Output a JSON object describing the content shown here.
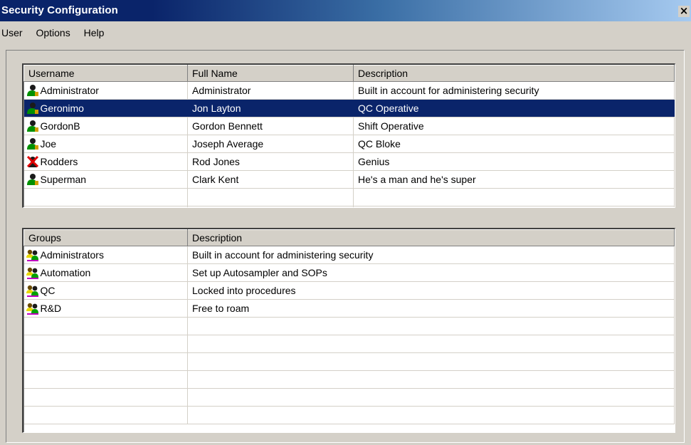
{
  "window": {
    "title": "Security Configuration",
    "close_glyph": "×"
  },
  "menu": [
    "User",
    "Options",
    "Help"
  ],
  "users": {
    "columns": [
      "Username",
      "Full Name",
      "Description"
    ],
    "rows": [
      {
        "username": "Administrator",
        "full_name": "Administrator",
        "description": "Built in account for administering security",
        "icon": "user-icon",
        "selected": false
      },
      {
        "username": "Geronimo",
        "full_name": "Jon Layton",
        "description": "QC Operative",
        "icon": "user-icon",
        "selected": true
      },
      {
        "username": "GordonB",
        "full_name": "Gordon Bennett",
        "description": "Shift Operative",
        "icon": "user-icon",
        "selected": false
      },
      {
        "username": "Joe",
        "full_name": "Joseph Average",
        "description": "QC Bloke",
        "icon": "user-icon",
        "selected": false
      },
      {
        "username": "Rodders",
        "full_name": "Rod Jones",
        "description": "Genius",
        "icon": "disabled-user-icon",
        "selected": false
      },
      {
        "username": "Superman",
        "full_name": "Clark Kent",
        "description": "He's a man and he's super",
        "icon": "user-icon",
        "selected": false
      }
    ]
  },
  "groups": {
    "columns": [
      "Groups",
      "Description"
    ],
    "rows": [
      {
        "name": "Administrators",
        "description": "Built in account for administering security",
        "icon": "group-icon"
      },
      {
        "name": "Automation",
        "description": "Set up Autosampler and SOPs",
        "icon": "group-icon"
      },
      {
        "name": "QC",
        "description": "Locked into procedures",
        "icon": "group-icon"
      },
      {
        "name": "R&D",
        "description": "Free to roam",
        "icon": "group-icon"
      }
    ]
  },
  "colors": {
    "selection": "#0a246a",
    "face": "#d4d0c8"
  }
}
